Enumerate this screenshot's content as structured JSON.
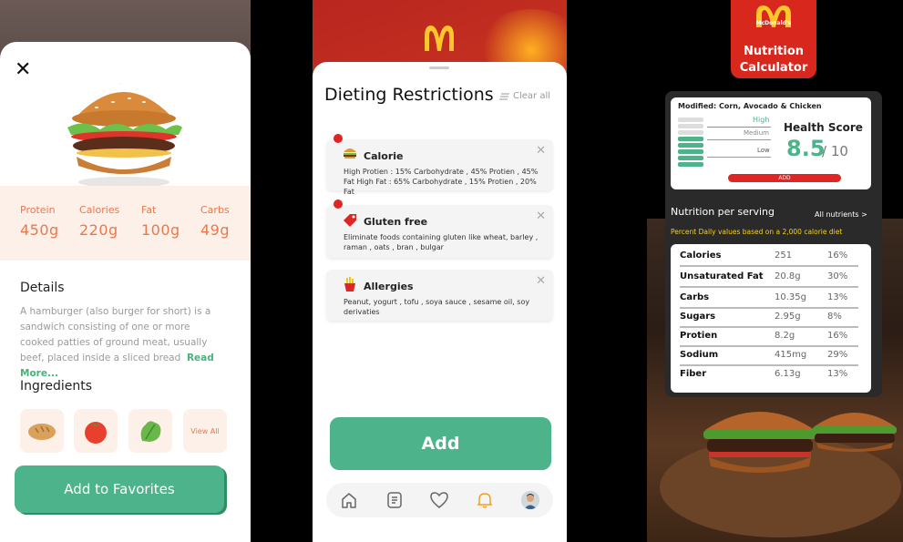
{
  "left": {
    "close": "✕",
    "macros": [
      {
        "label": "Protein",
        "value": "450g"
      },
      {
        "label": "Calories",
        "value": "220g"
      },
      {
        "label": "Fat",
        "value": "100g"
      },
      {
        "label": "Carbs",
        "value": "49g"
      }
    ],
    "details_title": "Details",
    "details_text": "A hamburger (also burger for short) is a sandwich consisting of one or more cooked patties of ground meat, usually beef, placed inside a sliced bread",
    "read_more": "Read More...",
    "ingredients_title": "Ingredients",
    "ingredients": [
      "bread",
      "tomato",
      "lettuce"
    ],
    "view_all": "View All",
    "favorites_button": "Add to Favorites"
  },
  "middle": {
    "title": "Dieting Restrictions",
    "clear_all": "Clear all",
    "restrictions": [
      {
        "title": "Calorie",
        "text": "High Protien : 15% Carbohydrate , 45% Protien , 45% Fat High Fat : 65% Carbohydrate , 15% Protien , 20% Fat",
        "icon": "burger-icon",
        "flagged": true
      },
      {
        "title": "Gluten free",
        "text": "Eliminate foods containing gluten like wheat, barley , raman , oats , bran , bulgar",
        "icon": "tag-icon",
        "flagged": true
      },
      {
        "title": "Allergies",
        "text": "Peanut, yogurt , tofu , soya sauce , sesame oil, soy derivaties",
        "icon": "fries-icon",
        "flagged": false
      }
    ],
    "add_button": "Add",
    "tabs": [
      "home-icon",
      "list-icon",
      "heart-icon",
      "bell-icon",
      "avatar"
    ]
  },
  "right": {
    "logo_text": "McDonald's",
    "app_title": "Nutrition Calculator",
    "modified": "Modified: Corn, Avocado & Chicken",
    "levels": [
      "High",
      "Medium",
      "Low"
    ],
    "health_score_title": "Health Score",
    "health_score": "8.5",
    "health_score_max": "/ 10",
    "add_label": "ADD",
    "nutrition_title": "Nutrition per serving",
    "all_nutrients": "All nutrients >",
    "daily_note": "Percent Daily values based on a 2,000 calorie diet",
    "nutrients": [
      {
        "name": "Calories",
        "value": "251",
        "pct": "16%"
      },
      {
        "name": "Unsaturated Fat",
        "value": "20.8g",
        "pct": "30%"
      },
      {
        "name": "Carbs",
        "value": "10.35g",
        "pct": "13%"
      },
      {
        "name": "Sugars",
        "value": "2.95g",
        "pct": "8%"
      },
      {
        "name": "Protien",
        "value": "8.2g",
        "pct": "16%"
      },
      {
        "name": "Sodium",
        "value": "415mg",
        "pct": "29%"
      },
      {
        "name": "Fiber",
        "value": "6.13g",
        "pct": "13%"
      }
    ]
  },
  "colors": {
    "accent_green": "#4cb38a",
    "brand_red": "#d8271c",
    "macro_orange": "#e8794f"
  }
}
